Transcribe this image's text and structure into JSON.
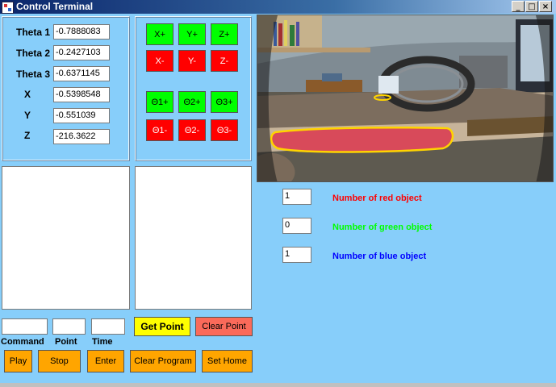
{
  "window": {
    "title": "Control Terminal",
    "minimize": "_",
    "maximize": "□",
    "close": "×"
  },
  "joints": [
    {
      "label": "Theta 1",
      "value": "-0.7888083"
    },
    {
      "label": "Theta 2",
      "value": "-0.2427103"
    },
    {
      "label": "Theta 3",
      "value": "-0.6371145"
    },
    {
      "label": "X",
      "value": "-0.5398548"
    },
    {
      "label": "Y",
      "value": "-0.551039"
    },
    {
      "label": "Z",
      "value": "-216.3622"
    }
  ],
  "jog": {
    "cartesian_plus": [
      "X+",
      "Y+",
      "Z+"
    ],
    "cartesian_minus": [
      "X-",
      "Y-",
      "Z-"
    ],
    "theta_plus": [
      "Θ1+",
      "Θ2+",
      "Θ3+"
    ],
    "theta_minus": [
      "Θ1-",
      "Θ2-",
      "Θ3-"
    ]
  },
  "program": {
    "command_label": "Command",
    "point_label": "Point",
    "time_label": "Time",
    "command_value": "",
    "point_value": "",
    "time_value": "",
    "get_point": "Get Point",
    "clear_point": "Clear Point",
    "play": "Play",
    "stop": "Stop",
    "enter": "Enter",
    "clear_program": "Clear Program",
    "set_home": "Set Home"
  },
  "detection": {
    "red": {
      "count": "1",
      "label": "Number of red object",
      "color": "#ff0000"
    },
    "green": {
      "count": "0",
      "label": "Number of green object",
      "color": "#00ff00"
    },
    "blue": {
      "count": "1",
      "label": "Number of blue object",
      "color": "#0000ff"
    }
  },
  "colors": {
    "background": "#87cefa",
    "jog_plus": "#00ff00",
    "jog_minus": "#ff0000",
    "action": "#ffa500"
  }
}
